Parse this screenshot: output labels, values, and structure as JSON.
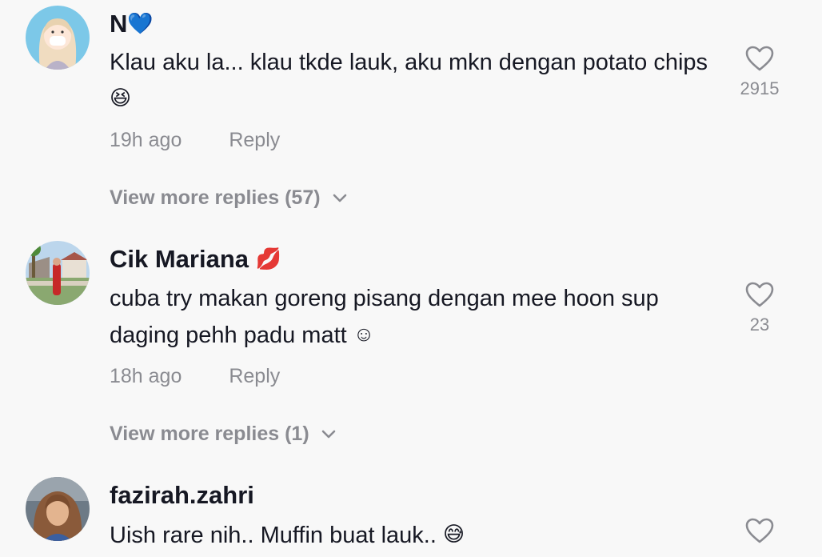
{
  "comments": [
    {
      "username": "N",
      "username_emoji": "💙",
      "text": "Klau aku la... klau tkde lauk, aku mkn dengan potato chips",
      "text_emoji": "😆",
      "time": "19h ago",
      "reply_label": "Reply",
      "likes": "2915",
      "view_more": "View more replies (57)"
    },
    {
      "username": "Cik Mariana",
      "username_emoji": "💋",
      "text": "cuba try makan goreng pisang dengan mee hoon sup daging pehh padu matt",
      "text_emoji": "☺",
      "time": "18h ago",
      "reply_label": "Reply",
      "likes": "23",
      "view_more": "View more replies (1)"
    },
    {
      "username": "fazirah.zahri",
      "username_emoji": "",
      "text": "Uish rare nih.. Muffin buat lauk..",
      "text_emoji": "😅",
      "time": "",
      "reply_label": "",
      "likes": "",
      "view_more": ""
    }
  ],
  "icons": {
    "like": "heart-outline-icon",
    "expand": "chevron-down-icon"
  },
  "colors": {
    "background": "#f8f8f8",
    "primary_text": "#161823",
    "secondary_text": "#8a8b91"
  }
}
